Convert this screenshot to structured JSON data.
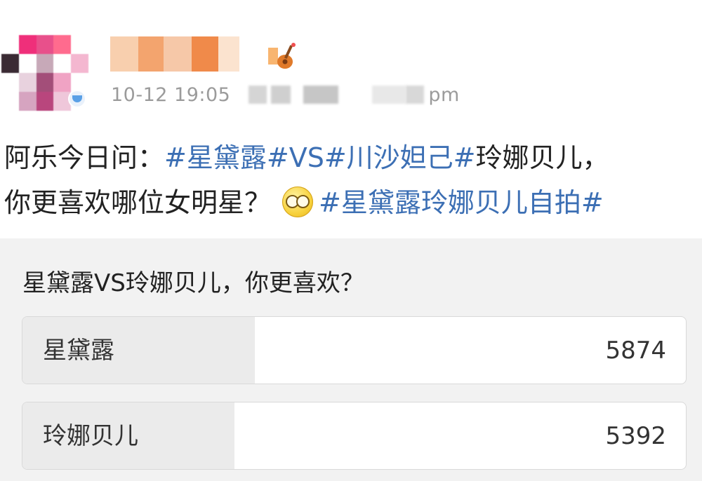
{
  "post": {
    "timestamp": "10-12 19:05",
    "source_suffix": "pm",
    "text_intro": "阿乐今日问：",
    "tag_1": "#星黛露#",
    "text_vs": "VS",
    "tag_2": "#川沙妲己#",
    "text_line1_end": "玲娜贝儿，",
    "text_line2": "你更喜欢哪位女明星？",
    "emoji_icon": "thinking-face-emoji",
    "tag_3": "#星黛露玲娜贝儿自拍#"
  },
  "poll": {
    "question": "星黛露VS玲娜贝儿，你更喜欢？",
    "options": [
      {
        "label": "星黛露",
        "count": "5874",
        "fraction": 0.35
      },
      {
        "label": "玲娜贝儿",
        "count": "5392",
        "fraction": 0.32
      }
    ]
  },
  "colors": {
    "hashtag": "#3c6fb4",
    "poll_background": "#f2f2f2",
    "option_fill": "#ebebeb"
  }
}
